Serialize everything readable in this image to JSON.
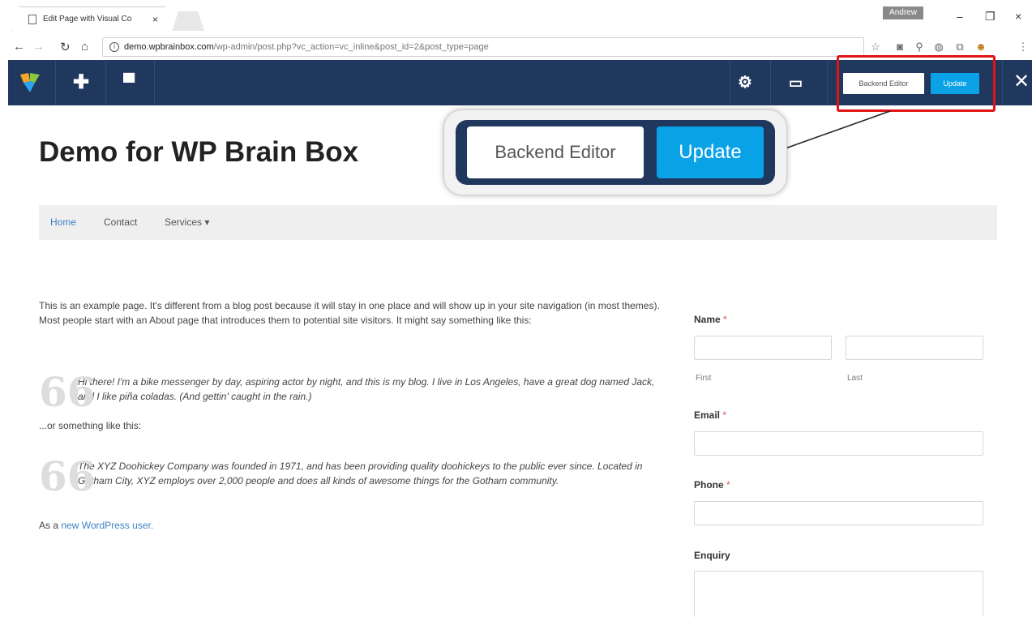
{
  "browser": {
    "tab_title": "Edit Page with Visual Co",
    "tab_close": "×",
    "profile_name": "Andrew",
    "window_minimize": "–",
    "window_restore": "❐",
    "window_close": "×",
    "url_host": "demo.wpbrainbox.com",
    "url_path": "/wp-admin/post.php?vc_action=vc_inline&post_id=2&post_type=page",
    "url_info": "i"
  },
  "vc_toolbar": {
    "add_icon": "✚",
    "layout_icon": "▀",
    "settings_icon": "⚙",
    "device_icon": "▭",
    "backend_label": "Backend Editor",
    "update_label": "Update",
    "close_icon": "✕",
    "accent": "#21385e",
    "update_color": "#0aa2e6"
  },
  "callout": {
    "backend_label": "Backend Editor",
    "update_label": "Update"
  },
  "page": {
    "site_title": "Demo for WP Brain Box",
    "nav": [
      "Home",
      "Contact",
      "Services ▾"
    ],
    "intro": "This is an example page. It's different from a blog post because it will stay in one place and will show up in your site navigation (in most themes). Most people start with an About page that introduces them to potential site visitors. It might say something like this:",
    "quote1": "Hi there! I'm a bike messenger by day, aspiring actor by night, and this is my blog. I live in Los Angeles, have a great dog named Jack, and I like piña coladas. (And gettin' caught in the rain.)",
    "or_text": "...or something like this:",
    "quote2": "The XYZ Doohickey Company was founded in 1971, and has been providing quality doohickeys to the public ever since. Located in Gotham City, XYZ employs over 2,000 people and does all kinds of awesome things for the Gotham community.",
    "outro_prefix": "As a ",
    "outro_link": "new WordPress user.",
    "quote_mark": "66"
  },
  "form": {
    "name_label": "Name",
    "required_mark": "*",
    "first_label": "First",
    "last_label": "Last",
    "email_label": "Email",
    "phone_label": "Phone",
    "enquiry_label": "Enquiry"
  }
}
